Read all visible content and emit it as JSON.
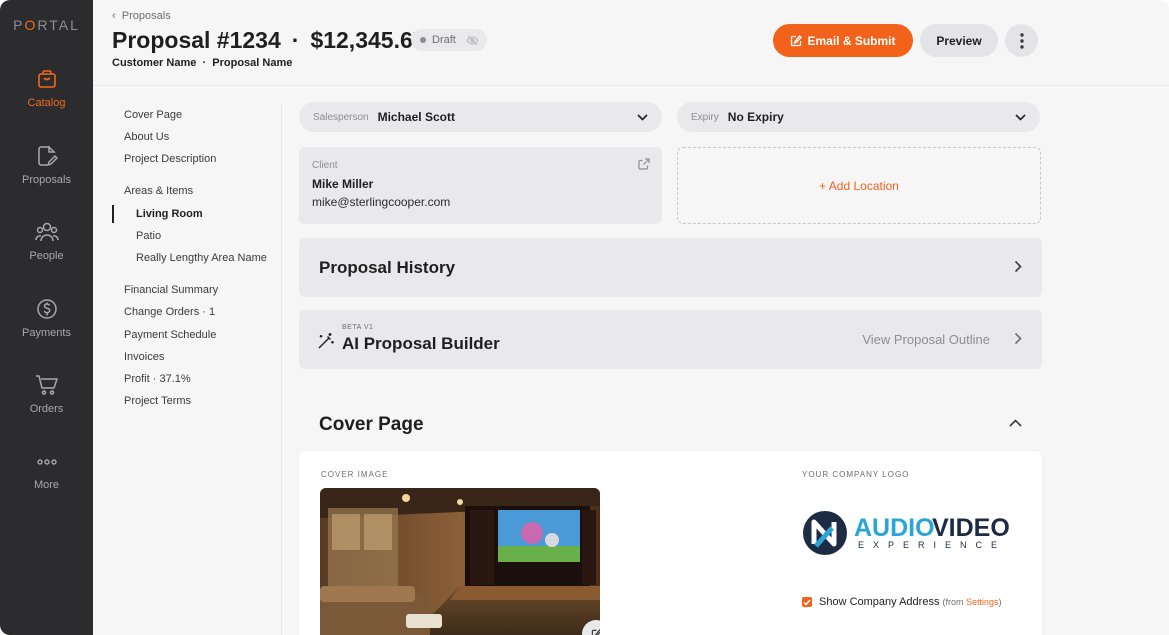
{
  "app": {
    "logo": "PORTAL"
  },
  "colors": {
    "accent": "#f2621b",
    "rail": "#2c2c2e"
  },
  "rail": {
    "items": [
      {
        "label": "Catalog",
        "icon": "bag-icon",
        "active": true
      },
      {
        "label": "Proposals",
        "icon": "document-edit-icon"
      },
      {
        "label": "People",
        "icon": "people-icon"
      },
      {
        "label": "Payments",
        "icon": "dollar-circle-icon"
      },
      {
        "label": "Orders",
        "icon": "cart-icon"
      },
      {
        "label": "More",
        "icon": "more-dots-icon"
      }
    ]
  },
  "header": {
    "breadcrumb": "Proposals",
    "title": "Proposal #1234",
    "amount": "$12,345.67",
    "status": "Draft",
    "customer": "Customer Name",
    "proposal_name": "Proposal Name",
    "email_submit_label": "Email & Submit",
    "preview_label": "Preview"
  },
  "sections": {
    "top": [
      "Cover Page",
      "About Us",
      "Project Description"
    ],
    "areas_label": "Areas & Items",
    "areas": [
      "Living Room",
      "Patio",
      "Really Lengthy Area Name"
    ],
    "active_area": "Living Room",
    "bottom": [
      "Financial Summary",
      "Change Orders · 1",
      "Payment Schedule",
      "Invoices",
      "Profit · 37.1%",
      "Project Terms"
    ]
  },
  "main": {
    "salesperson": {
      "label": "Salesperson",
      "value": "Michael Scott"
    },
    "expiry": {
      "label": "Expiry",
      "value": "No Expiry"
    },
    "client": {
      "label": "Client",
      "name": "Mike Miller",
      "email": "mike@sterlingcooper.com"
    },
    "add_location": "+ Add Location",
    "history_title": "Proposal History",
    "ai": {
      "beta": "BETA V1",
      "title": "AI Proposal Builder",
      "outline": "View Proposal Outline"
    },
    "cover": {
      "title": "Cover Page",
      "image_label": "COVER IMAGE",
      "logo_label": "YOUR COMPANY LOGO",
      "logo_word1": "AUDIO",
      "logo_word2": "VIDEO",
      "logo_sub": "EXPERIENCE",
      "show_address": "Show Company Address",
      "from_prefix": "(from ",
      "settings_link": "Settings",
      "from_suffix": ")",
      "show_address_checked": true
    }
  }
}
